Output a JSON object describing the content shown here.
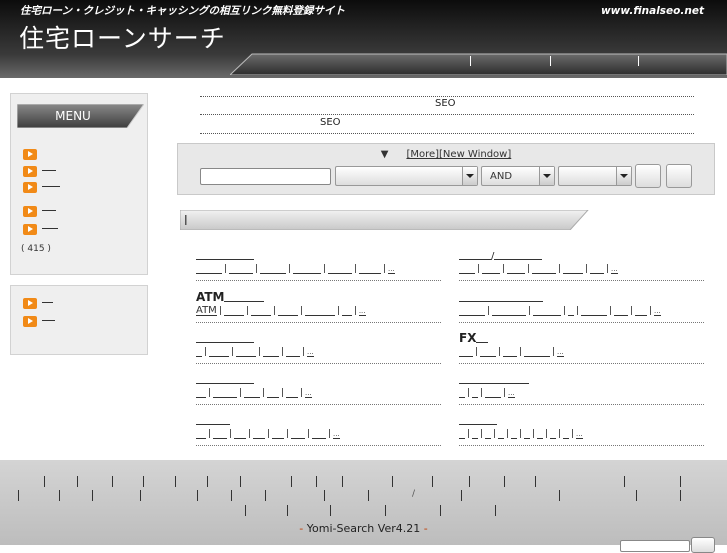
{
  "header": {
    "tagline": "住宅ローン・クレジット・キャッシングの相互リンク無料登録サイト",
    "site_url": "www.finalseo.net",
    "site_title": "住宅ローンサーチ"
  },
  "menu": {
    "title": "MENU",
    "count_text": "(   415   )"
  },
  "intro": {
    "line1": "SEO",
    "line2": "SEO"
  },
  "search": {
    "more_label": "[More]",
    "new_window_label": "[New Window]",
    "marker": "▼",
    "logic_value": "AND"
  },
  "categories": {
    "c3_head": "ATM",
    "c3_sub1": "ATM",
    "c6_head": "FX",
    "c2_head_sep": "/"
  },
  "footer": {
    "credit_prefix": "- ",
    "credit_link": "Yomi-Search Ver4.21",
    "credit_suffix": " -"
  },
  "colors": {
    "header_bg": "#1a1a1a",
    "accent_orange": "#f18a17",
    "footer_bg": "#c9c9c9"
  }
}
